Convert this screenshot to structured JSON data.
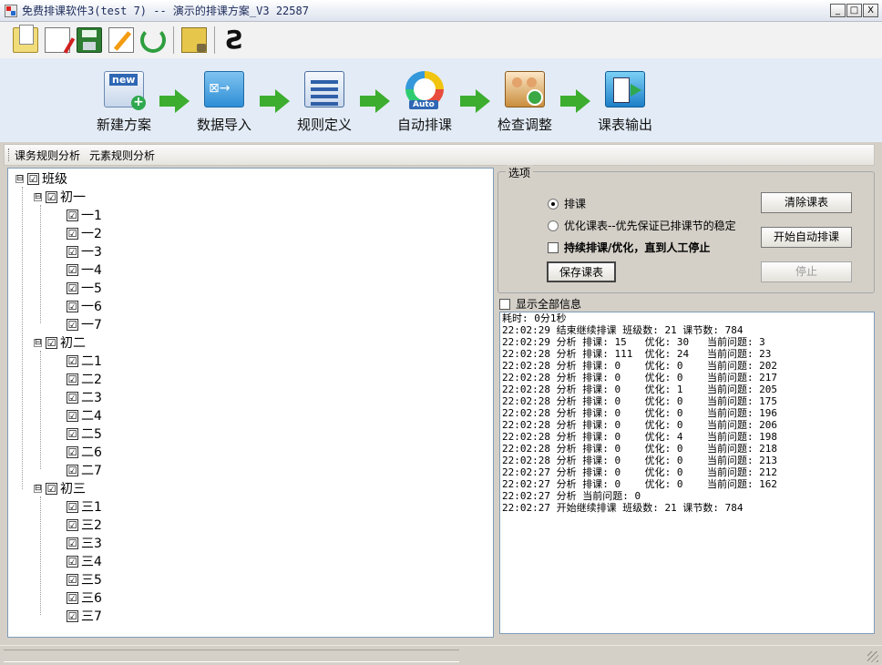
{
  "window": {
    "title": "免费排课软件3(test  7) -- 演示的排课方案_V3  22587",
    "buttons": [
      "_",
      "□",
      "X"
    ]
  },
  "toolbar": {
    "icons": [
      "open-icon",
      "new-icon",
      "save-icon",
      "edit-icon",
      "refresh-icon",
      "lock-icon",
      "connect-icon"
    ]
  },
  "workflow": {
    "steps": [
      {
        "label": "新建方案",
        "icon": "new-plan-icon"
      },
      {
        "label": "数据导入",
        "icon": "data-import-icon"
      },
      {
        "label": "规则定义",
        "icon": "rules-icon"
      },
      {
        "label": "自动排课",
        "icon": "auto-schedule-icon"
      },
      {
        "label": "检查调整",
        "icon": "check-adjust-icon"
      },
      {
        "label": "课表输出",
        "icon": "timetable-output-icon"
      }
    ]
  },
  "tabs": [
    "课务规则分析",
    "元素规则分析"
  ],
  "tree": {
    "root": {
      "label": "班级",
      "expander": "⊟",
      "checked": "☑"
    },
    "groups": [
      {
        "label": "初一",
        "expander": "⊟",
        "items": [
          "一1",
          "一2",
          "一3",
          "一4",
          "一5",
          "一6",
          "一7"
        ]
      },
      {
        "label": "初二",
        "expander": "⊟",
        "items": [
          "二1",
          "二2",
          "二3",
          "二4",
          "二5",
          "二6",
          "二7"
        ]
      },
      {
        "label": "初三",
        "expander": "⊟",
        "items": [
          "三1",
          "三2",
          "三3",
          "三4",
          "三5",
          "三6",
          "三7"
        ]
      }
    ]
  },
  "options": {
    "legend": "选项",
    "radio_schedule": "排课",
    "radio_optimize": "优化课表--优先保证已排课节的稳定",
    "check_continuous": "持续排课/优化，直到人工停止",
    "btn_save": "保存课表",
    "btn_clear": "清除课表",
    "btn_start": "开始自动排课",
    "btn_stop": "停止"
  },
  "show_all": "显示全部信息",
  "log": [
    "耗时: 0分1秒",
    "22:02:29 结束继续排课 班级数: 21 课节数: 784",
    "22:02:29 分析 排课: 15   优化: 30   当前问题: 3",
    "22:02:28 分析 排课: 111  优化: 24   当前问题: 23",
    "22:02:28 分析 排课: 0    优化: 0    当前问题: 202",
    "22:02:28 分析 排课: 0    优化: 0    当前问题: 217",
    "22:02:28 分析 排课: 0    优化: 1    当前问题: 205",
    "22:02:28 分析 排课: 0    优化: 0    当前问题: 175",
    "22:02:28 分析 排课: 0    优化: 0    当前问题: 196",
    "22:02:28 分析 排课: 0    优化: 0    当前问题: 206",
    "22:02:28 分析 排课: 0    优化: 4    当前问题: 198",
    "22:02:28 分析 排课: 0    优化: 0    当前问题: 218",
    "22:02:28 分析 排课: 0    优化: 0    当前问题: 213",
    "22:02:27 分析 排课: 0    优化: 0    当前问题: 212",
    "22:02:27 分析 排课: 0    优化: 0    当前问题: 162",
    "22:02:27 分析 当前问题: 0",
    "22:02:27 开始继续排课 班级数: 21 课节数: 784"
  ]
}
